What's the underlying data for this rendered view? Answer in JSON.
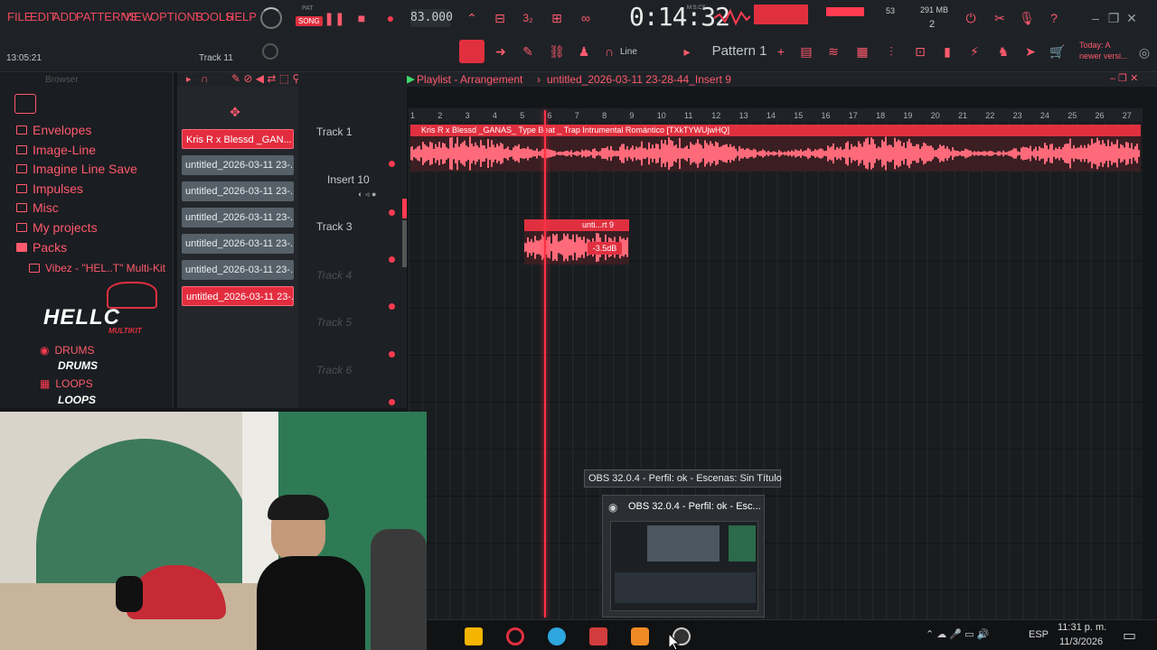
{
  "menu": [
    "FILE",
    "EDIT",
    "ADD",
    "PATTERNS",
    "VIEW",
    "OPTIONS",
    "TOOLS",
    "HELP"
  ],
  "transport": {
    "pat_label": "PAT",
    "song_label": "SONG",
    "tempo": "83.000",
    "time": "0:14:32",
    "time_unit": "M:S:CS"
  },
  "status": {
    "clock": "13:05:21",
    "hint_track": "Track 11",
    "cpu_value": "53",
    "memory": "291 MB",
    "polyphony": "2"
  },
  "toolbar": {
    "snap_label": "Line",
    "pattern_label": "Pattern 1",
    "news": "Today: A newer versi..."
  },
  "browser": {
    "title": "Browser",
    "items": [
      "Envelopes",
      "Image-Line",
      "Imagine Line Save",
      "Impulses",
      "Misc",
      "My projects",
      "Packs"
    ],
    "pack": "Vibez - \"HEL..T\" Multi-Kit",
    "logo_main": "HELLC",
    "logo_sub": "MULTIKIT",
    "drums": "DRUMS",
    "drums_logo": "DRUMS",
    "loops": "LOOPS",
    "loops_logo": "LOOPS"
  },
  "channels": [
    "Kris R x Blessd _GAN...",
    "untitled_2026-03-11 23-...",
    "untitled_2026-03-11 23-...",
    "untitled_2026-03-11 23-...",
    "untitled_2026-03-11 23-...",
    "untitled_2026-03-11 23-...",
    "untitled_2026-03-11 23-..."
  ],
  "playlist": {
    "title": "Playlist - Arrangement",
    "project": "untitled_2026-03-11 23-28-44_Insert 9",
    "tracks": [
      "Track 1",
      "Insert 10",
      "Track 3",
      "Track 4",
      "Track 5",
      "Track 6"
    ],
    "ruler": [
      "1",
      "2",
      "3",
      "4",
      "5",
      "6",
      "7",
      "8",
      "9",
      "10",
      "11",
      "12",
      "13",
      "14",
      "15",
      "16",
      "17",
      "18",
      "19",
      "20",
      "21",
      "22",
      "23",
      "24",
      "25",
      "26",
      "27"
    ],
    "clip1": "Kris R x Blessd _GANAS_ Type Beat _ Trap Intrumental Romántico [TXkTYWUjwHQ]",
    "clip3": "unti...rt 9",
    "clip3_gain": "-3.5dB"
  },
  "obs": {
    "tooltip": "OBS 32.0.4 - Perfil: ok - Escenas: Sin Título",
    "thumb_title": "OBS 32.0.4 - Perfil: ok - Esc..."
  },
  "taskbar": {
    "lang": "ESP",
    "time": "11:31 p. m.",
    "date": "11/3/2026"
  },
  "colors": {
    "accent": "#ff3b50",
    "clip": "#e0303f",
    "selected_channel": "#e32d3f"
  }
}
